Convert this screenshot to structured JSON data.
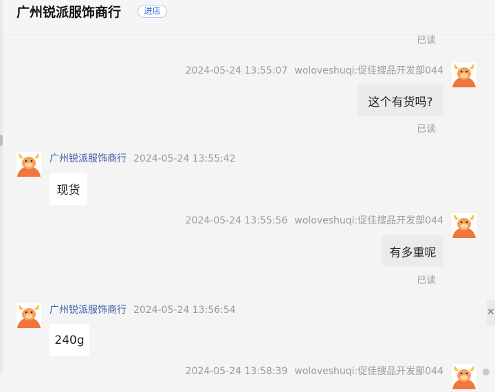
{
  "header": {
    "shop_name": "广州锐派服饰商行",
    "enter_store": "进店"
  },
  "read_label": "已读",
  "messages": [
    {
      "direction": "out",
      "time": "2024-05-24 13:55:07",
      "sender": "woloveshuqi:促佳搜品开发部044",
      "text": "这个有货吗?"
    },
    {
      "direction": "in",
      "sender": "广州锐派服饰商行",
      "time": "2024-05-24 13:55:42",
      "text": "现货"
    },
    {
      "direction": "out",
      "time": "2024-05-24 13:55:56",
      "sender": "woloveshuqi:促佳搜品开发部044",
      "text": "有多重呢"
    },
    {
      "direction": "in",
      "sender": "广州锐派服饰商行",
      "time": "2024-05-24 13:56:54",
      "text": "240g"
    },
    {
      "direction": "out",
      "time": "2024-05-24 13:58:39",
      "sender": "woloveshuqi:促佳搜品开发部044",
      "text": ""
    }
  ],
  "right_panel": {
    "close_glyph": "✕"
  },
  "colors": {
    "shop_name_link": "#3b5ba8",
    "out_bubble": "#ebebeb",
    "in_bubble": "#ffffff",
    "avatar_orange": "#f0763a"
  },
  "icons": {
    "avatar": "bull-mascot-avatar-icon"
  }
}
